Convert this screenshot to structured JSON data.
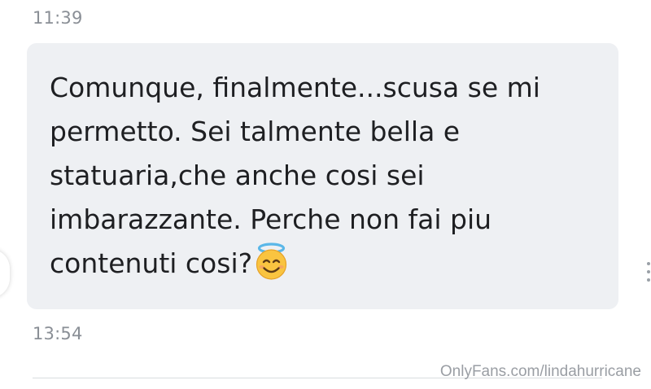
{
  "chat": {
    "timestamp_top": "11:39",
    "timestamp_bottom": "13:54",
    "message": {
      "lines": [
        "Comunque, finalmente...scusa se mi",
        "permetto. Sei talmente bella e",
        "statuaria,che anche cosi sei",
        "imbarazzante. Perche non fai piu",
        "contenuti cosi?"
      ],
      "emoji": "smiling-face-with-halo"
    }
  },
  "watermark": "OnlyFans.com/lindahurricane"
}
